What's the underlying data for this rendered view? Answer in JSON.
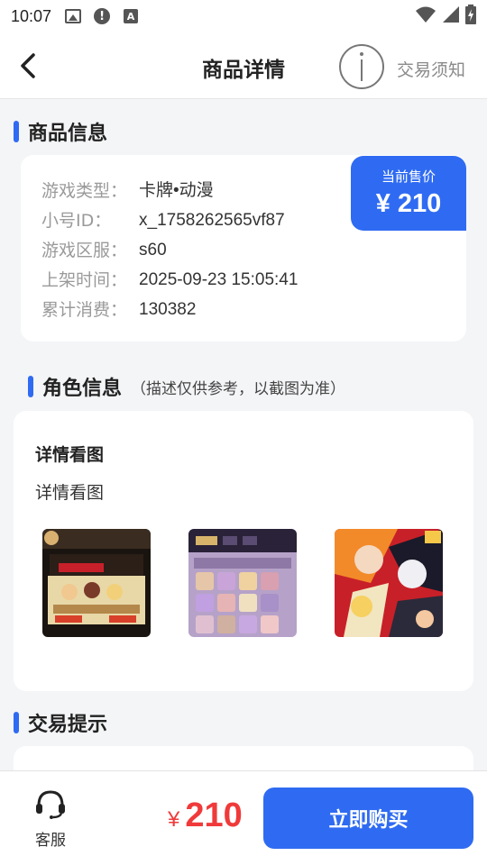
{
  "status_bar": {
    "time": "10:07",
    "icons": [
      "gallery-icon",
      "alert-icon",
      "font-a-icon",
      "wifi-icon",
      "signal-icon",
      "battery-charging-icon"
    ]
  },
  "header": {
    "title": "商品详情",
    "notice_label": "交易须知"
  },
  "product_info": {
    "section_title": "商品信息",
    "price_label": "当前售价",
    "price": "¥ 210",
    "rows": [
      {
        "key": "游戏类型：",
        "value": "卡牌•动漫"
      },
      {
        "key": "小号ID：",
        "value": "x_1758262565vf87"
      },
      {
        "key": "游戏区服：",
        "value": "s60"
      },
      {
        "key": "上架时间：",
        "value": "2025-09-23 15:05:41"
      },
      {
        "key": "累计消费：",
        "value": "130382"
      }
    ]
  },
  "role_info": {
    "section_title": "角色信息",
    "section_note": "（描述仅供参考，以截图为准）",
    "detail_heading": "详情看图",
    "detail_text": "详情看图"
  },
  "trade_tips": {
    "section_title": "交易提示"
  },
  "bottom_bar": {
    "service_label": "客服",
    "currency": "¥",
    "price": "210",
    "buy_label": "立即购买"
  },
  "colors": {
    "accent": "#2f6bf2",
    "price_red": "#f03a3a",
    "background": "#f4f5f7"
  }
}
